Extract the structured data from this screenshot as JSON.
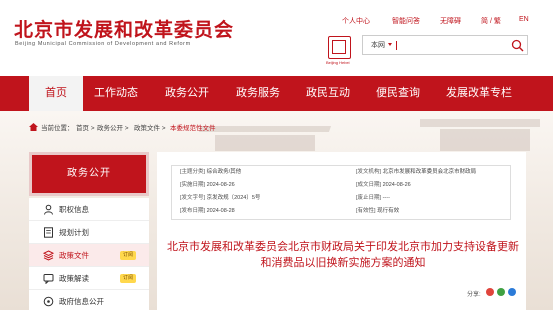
{
  "header": {
    "title": "北京市发展和改革委员会",
    "subtitle": "Beijing Municipal Commission of Development and Reform",
    "top_links": [
      "个人中心",
      "智能问答",
      "无障碍",
      "简 / 繁",
      "EN"
    ],
    "seal_caption": "Beijing Hebei"
  },
  "search": {
    "scope": "本网",
    "value": ""
  },
  "nav": {
    "items": [
      "首页",
      "工作动态",
      "政务公开",
      "政务服务",
      "政民互动",
      "便民查询",
      "发展改革专栏"
    ],
    "active_index": 0
  },
  "breadcrumb": {
    "items": [
      "当前位置：",
      "首页 >",
      "政务公开 >",
      "政策文件 >",
      "本委规范性文件"
    ]
  },
  "sidebar": {
    "header": "政务公开",
    "items": [
      {
        "label": "职权信息",
        "icon": "person-icon",
        "badge": ""
      },
      {
        "label": "规划计划",
        "icon": "document-icon",
        "badge": ""
      },
      {
        "label": "政策文件",
        "icon": "stack-icon",
        "badge": "订阅"
      },
      {
        "label": "政策解读",
        "icon": "chat-icon",
        "badge": "订阅"
      },
      {
        "label": "政府信息公开",
        "icon": "circle-icon",
        "badge": ""
      }
    ],
    "active_index": 2
  },
  "document": {
    "meta": [
      [
        {
          "label": "[主题分类]",
          "value": "综合政务/其他"
        },
        {
          "label": "[发文机构]",
          "value": "北京市发展和改革委员会北京市财政局"
        }
      ],
      [
        {
          "label": "[实施日期]",
          "value": "2024-08-26"
        },
        {
          "label": "[成文日期]",
          "value": "2024-08-26"
        }
      ],
      [
        {
          "label": "[发文字号]",
          "value": "京发改规〔2024〕5号"
        },
        {
          "label": "[废止日期]",
          "value": "----"
        }
      ],
      [
        {
          "label": "[发布日期]",
          "value": "2024-08-28"
        },
        {
          "label": "[有效性]",
          "value": "现行有效"
        }
      ]
    ],
    "title": "北京市发展和改革委员会北京市财政局关于印发北京市加力支持设备更新和消费品以旧换新实施方案的通知",
    "share_label": "分享:"
  },
  "colors": {
    "brand_red": "#c0141c",
    "badge_yellow": "#ffd84d"
  }
}
